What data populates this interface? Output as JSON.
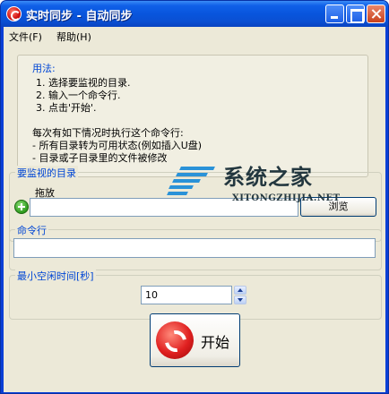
{
  "window": {
    "title": "实时同步 - 自动同步"
  },
  "menu": {
    "file": "文件(F)",
    "help": "帮助(H)"
  },
  "usage": {
    "title": "用法:",
    "steps": [
      "1. 选择要监视的目录.",
      "2. 输入一个命令行.",
      "3. 点击'开始'."
    ],
    "note": "每次有如下情况时执行这个命令行:",
    "conditions": [
      "- 所有目录转为可用状态(例如插入U盘)",
      "- 目录或子目录里的文件被修改"
    ]
  },
  "watch": {
    "group_label": "要监视的目录",
    "drag_label": "拖放",
    "dir_value": "",
    "browse_label": "浏览"
  },
  "command": {
    "group_label": "命令行",
    "value": ""
  },
  "idle": {
    "group_label": "最小空闲时间[秒]",
    "value": "10"
  },
  "start": {
    "label": "开始"
  },
  "watermark": {
    "main": "系统之家",
    "sub": "XITONGZHIJIA.NET"
  },
  "colors": {
    "title_bar": "#0855dd",
    "group_label": "#0046d5",
    "client_bg": "#ece9d8"
  },
  "icons": {
    "app": "sync-icon",
    "add": "plus-icon",
    "start": "refresh-arrows-icon"
  }
}
